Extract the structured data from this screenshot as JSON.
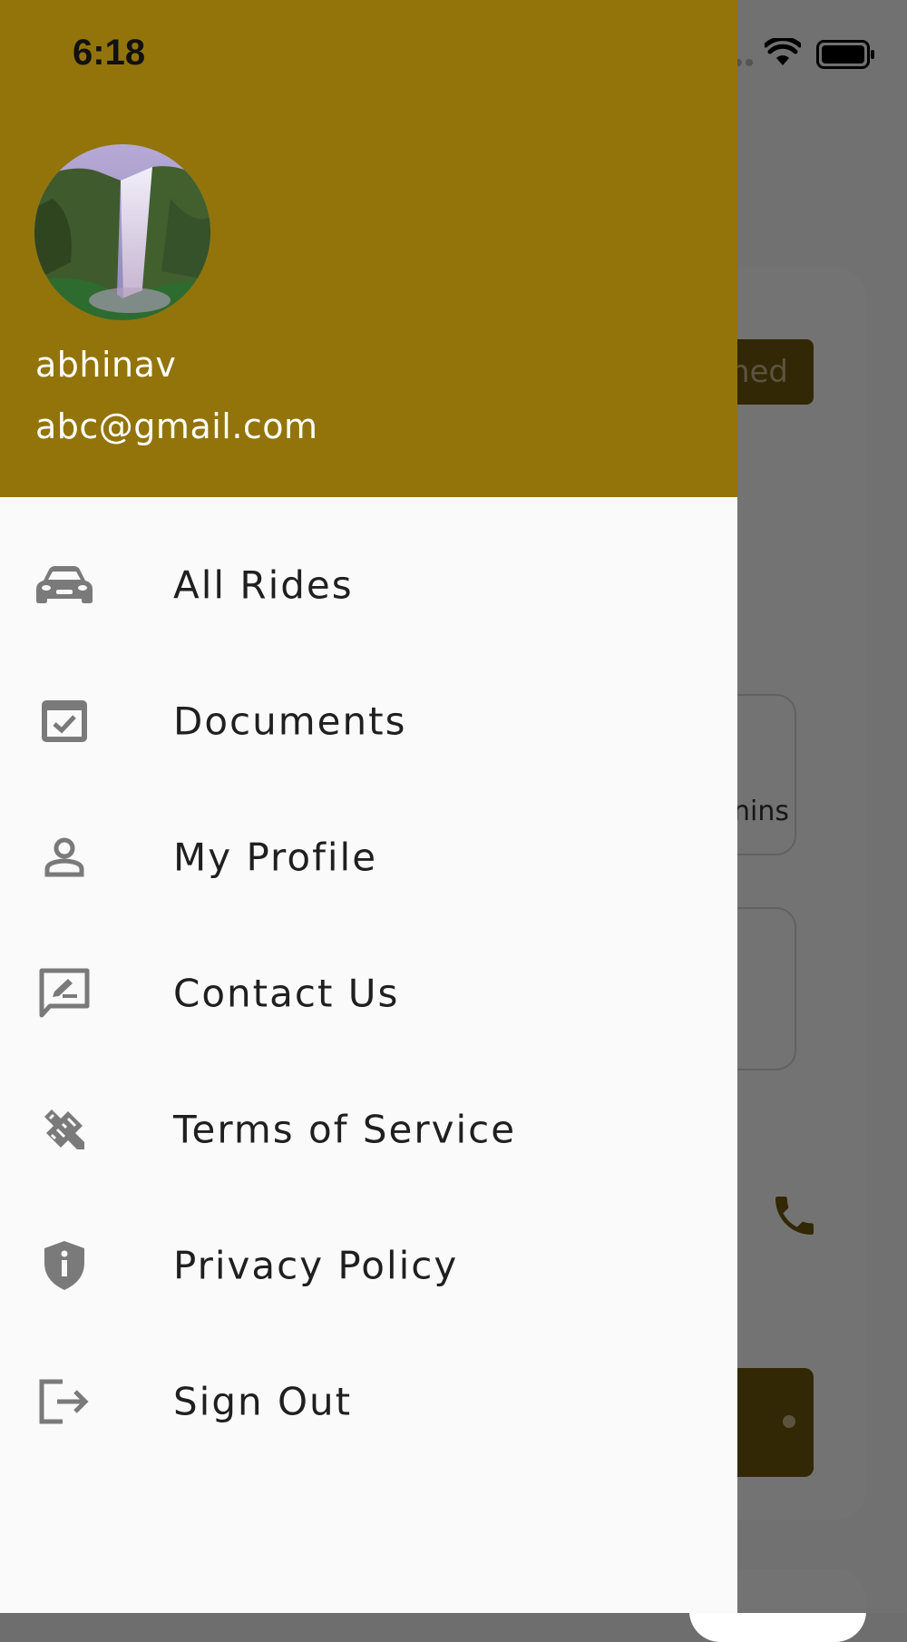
{
  "status_bar": {
    "time": "6:18"
  },
  "drawer": {
    "user_name": "abhinav",
    "user_email": "abc@gmail.com",
    "items": [
      {
        "label": "All Rides",
        "icon": "car-icon"
      },
      {
        "label": "Documents",
        "icon": "checkbox-document-icon"
      },
      {
        "label": "My Profile",
        "icon": "person-icon"
      },
      {
        "label": "Contact Us",
        "icon": "feedback-icon"
      },
      {
        "label": "Terms of Service",
        "icon": "design-services-icon"
      },
      {
        "label": "Privacy Policy",
        "icon": "privacy-shield-icon"
      },
      {
        "label": "Sign Out",
        "icon": "logout-icon"
      }
    ]
  },
  "background": {
    "status_badge_partial": "ned",
    "duration_partial": "nins"
  },
  "colors": {
    "header": "#92740b",
    "drawer_bg": "#fafafa",
    "icon": "#7a7a7a",
    "text": "#1f1f1f"
  }
}
